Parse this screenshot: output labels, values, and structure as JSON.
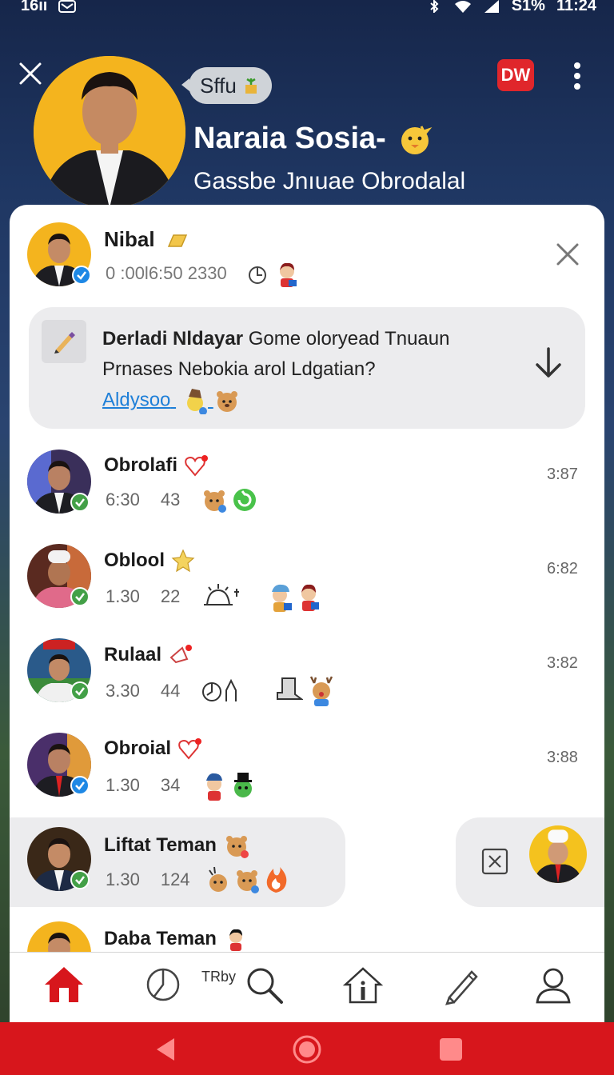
{
  "status_bar": {
    "carrier": "16ıı",
    "clock": "11:24",
    "battery": "S1%"
  },
  "header": {
    "pill_text": "Sffu",
    "title": "Naraia Sosia-",
    "subtitle": "Gassbe Jnıuae Obrodalal",
    "badge": "DW"
  },
  "top_contact": {
    "name": "Nibal",
    "meta": "0 :00l6:50  2330"
  },
  "notice": {
    "bold": "Derladi Nldayar",
    "line1_rest": " Gome oloryead Tnuaun",
    "line2": "Prnases Nebokia arol Ldgatian?",
    "link": "Aldysoo"
  },
  "chats": [
    {
      "name": "Obrolafi",
      "a": "6:30",
      "b": "43",
      "time": "3:87"
    },
    {
      "name": "Oblool",
      "a": "1.30",
      "b": "22",
      "time": "6:82"
    },
    {
      "name": "Rulaal",
      "a": "3.30",
      "b": "44",
      "time": "3:82"
    },
    {
      "name": "Obroial",
      "a": "1.30",
      "b": "34",
      "time": "3:88"
    },
    {
      "name": "Liftat Teman",
      "a": "1.30",
      "b": "124",
      "time": ""
    },
    {
      "name": "Daba Teman",
      "a": "",
      "b": "",
      "time": ""
    }
  ],
  "bottom_nav": {
    "tiny_label": "TRby"
  },
  "colors": {
    "accent_red": "#d7161c",
    "link_blue": "#1e7fd8",
    "hero_yellow": "#f4b41e"
  }
}
